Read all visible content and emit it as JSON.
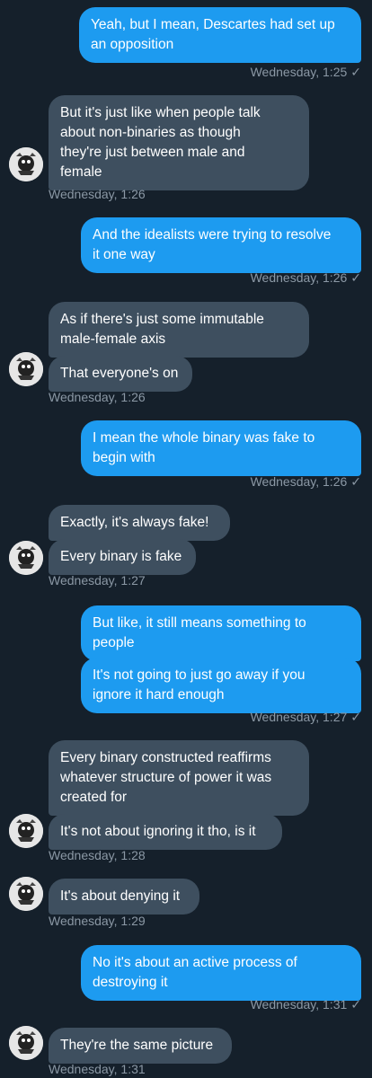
{
  "messages": [
    {
      "dir": "out",
      "text": "Yeah, but I mean, Descartes had set up\nan opposition"
    },
    {
      "dir": "out_ts",
      "text": "Wednesday, 1:25"
    },
    {
      "dir": "in",
      "text": "But it's just like when people talk\nabout non-binaries as though\nthey're just between male and\nfemale"
    },
    {
      "dir": "in_ts",
      "text": "Wednesday, 1:26"
    },
    {
      "dir": "out",
      "text": "And the idealists were trying to resolve\nit one way"
    },
    {
      "dir": "out_ts",
      "text": "Wednesday, 1:26"
    },
    {
      "dir": "in",
      "text": "As if there's just some immutable\nmale-female axis"
    },
    {
      "dir": "in",
      "text": "That everyone's on"
    },
    {
      "dir": "in_ts",
      "text": "Wednesday, 1:26"
    },
    {
      "dir": "out",
      "text": "I mean the whole binary was fake to\nbegin with"
    },
    {
      "dir": "out_ts",
      "text": "Wednesday, 1:26"
    },
    {
      "dir": "in",
      "text": "Exactly, it's always fake!"
    },
    {
      "dir": "in",
      "text": "Every binary is fake"
    },
    {
      "dir": "in_ts",
      "text": "Wednesday, 1:27"
    },
    {
      "dir": "out",
      "text": "But like, it still means something to\npeople"
    },
    {
      "dir": "out",
      "text": "It's not going to just go away if you\nignore it hard enough"
    },
    {
      "dir": "out_ts",
      "text": "Wednesday, 1:27"
    },
    {
      "dir": "in",
      "text": "Every binary constructed reaffirms\nwhatever structure of power it was\ncreated for"
    },
    {
      "dir": "in",
      "text": "It's not about ignoring it tho, is it"
    },
    {
      "dir": "in_ts",
      "text": "Wednesday, 1:28"
    },
    {
      "dir": "in",
      "text": "It's about denying it"
    },
    {
      "dir": "in_ts",
      "text": "Wednesday, 1:29"
    },
    {
      "dir": "out",
      "text": "No it's about an active process of\ndestroying it"
    },
    {
      "dir": "out_ts",
      "text": "Wednesday, 1:31"
    },
    {
      "dir": "in",
      "text": "They're the same picture"
    },
    {
      "dir": "in_ts",
      "text": "Wednesday, 1:31"
    }
  ],
  "read_icon": "check-icon",
  "colors": {
    "background": "#15202b",
    "outgoing_bubble": "#1d9bf0",
    "incoming_bubble": "#3e4f5f",
    "timestamp": "#8b98a5"
  },
  "avatar_icon": "user-avatar"
}
